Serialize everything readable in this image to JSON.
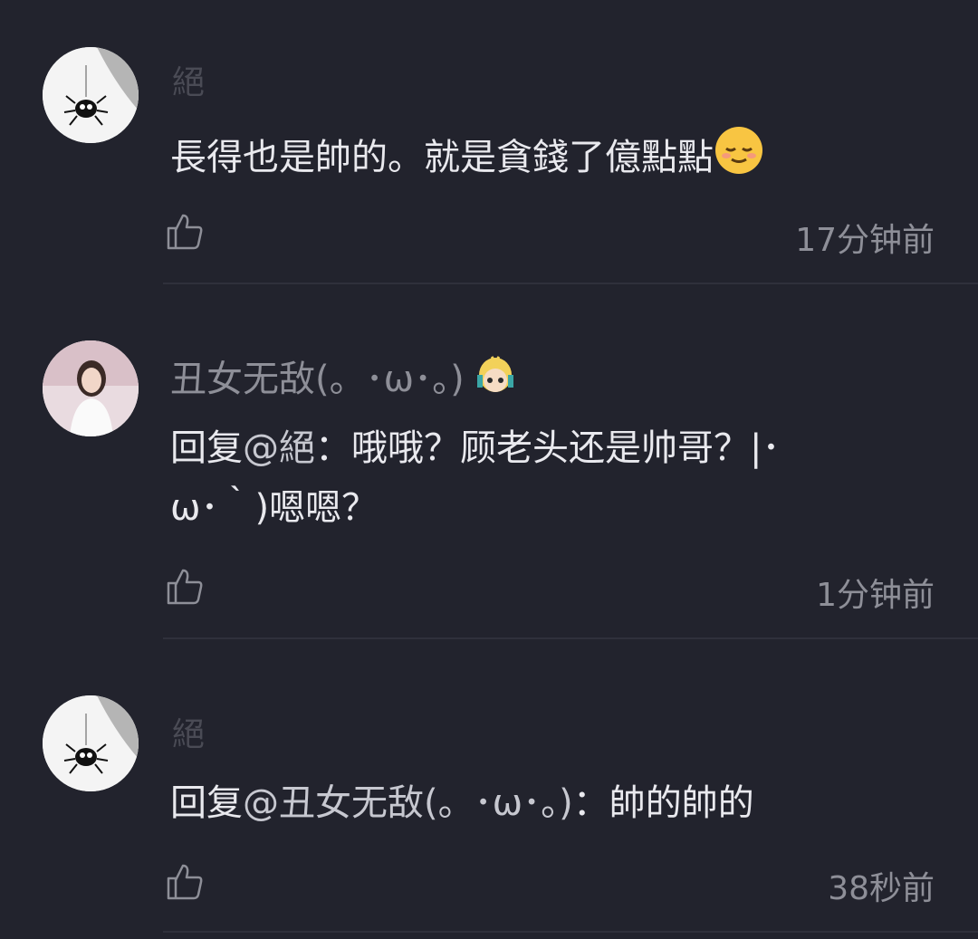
{
  "comments": [
    {
      "username": "絕",
      "text": "長得也是帥的。就是貪錢了億點點",
      "emoji": "relieved-face-emoji",
      "time": "17分钟前"
    },
    {
      "username": "丑女无敌(。･ω･。)",
      "reply_prefix": "回复",
      "mention": "@絕",
      "text_line1": "：哦哦？顾老头还是帅哥？|･",
      "text_line2": "ω･｀)嗯嗯？",
      "badge": "avatar-badge-emoji",
      "time": "1分钟前"
    },
    {
      "username": "絕",
      "reply_prefix": "回复",
      "mention": "@丑女无敌(。･ω･。)",
      "text": "：帥的帥的",
      "time": "38秒前"
    }
  ]
}
